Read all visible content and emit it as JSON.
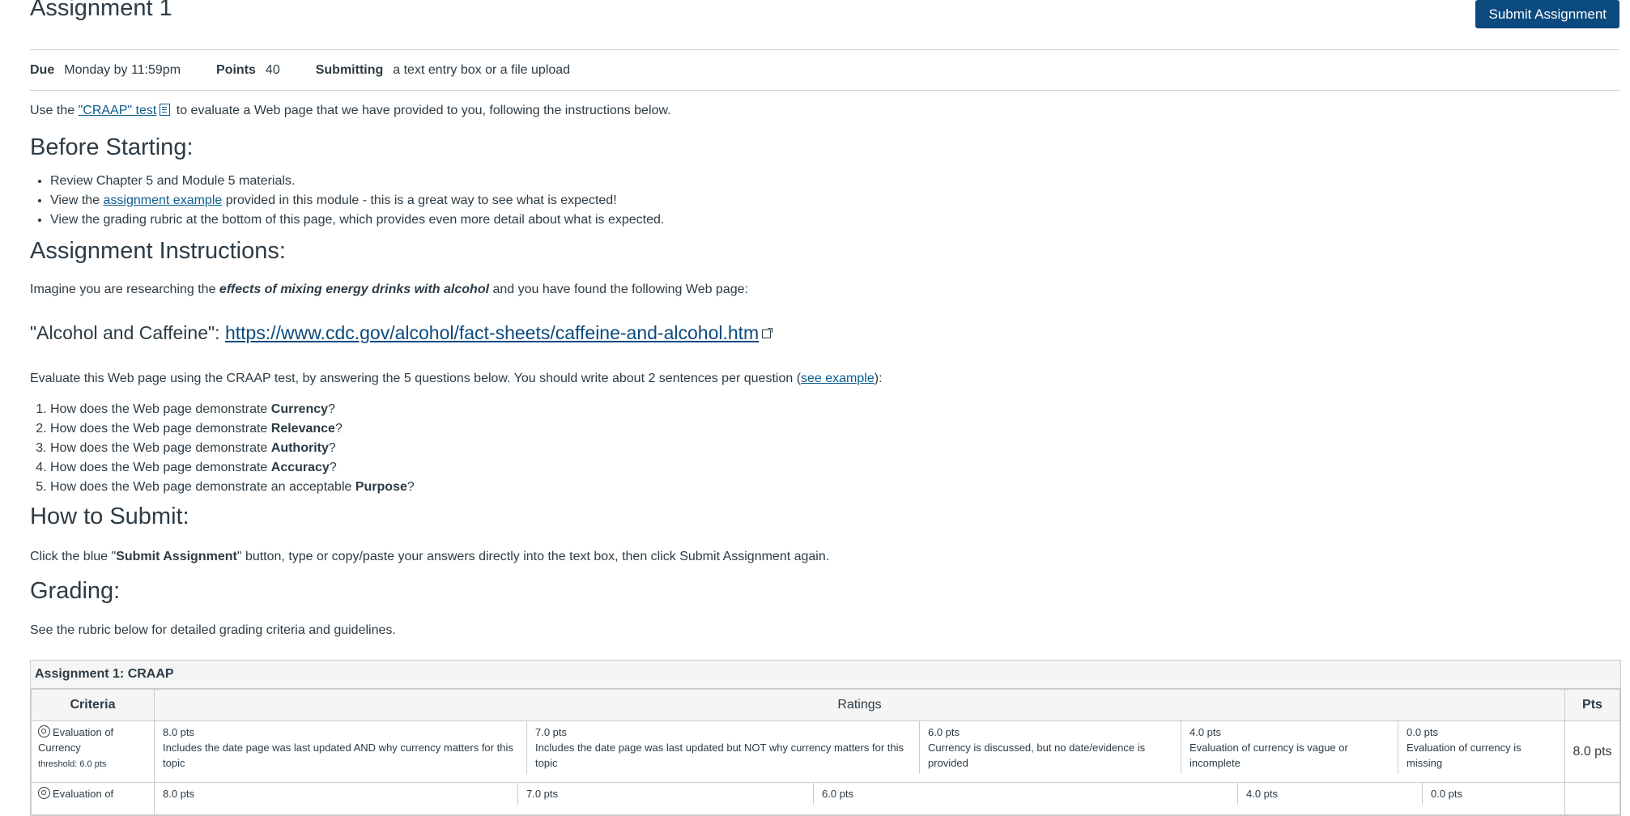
{
  "title": "Assignment 1",
  "submit_label": "Submit Assignment",
  "details": {
    "due_label": "Due",
    "due_value": "Monday by 11:59pm",
    "points_label": "Points",
    "points_value": "40",
    "submitting_label": "Submitting",
    "submitting_value": "a text entry box or a file upload"
  },
  "intro": {
    "pre": "Use the ",
    "link": "\"CRAAP\" test",
    "post": " to evaluate a Web page that we have provided to you, following the instructions below."
  },
  "before": {
    "heading": "Before Starting:",
    "item1": "Review Chapter 5 and Module 5 materials.",
    "item2_pre": "View the ",
    "item2_link": "assignment example",
    "item2_post": " provided in this module - this is a great way to see what is expected!",
    "item3": "View the grading rubric at the bottom of this page, which provides even more detail about what is expected."
  },
  "instructions": {
    "heading": "Assignment Instructions:",
    "imagine_pre": "Imagine you are researching the ",
    "imagine_em": "effects of mixing energy drinks with alcohol",
    "imagine_post": " and you have found the following Web page:",
    "cdc_label": "\"Alcohol and Caffeine\": ",
    "cdc_link": "https://www.cdc.gov/alcohol/fact-sheets/caffeine-and-alcohol.htm",
    "eval_pre": "Evaluate this Web page using the CRAAP test, by answering the 5 questions below. You should write about 2 sentences per question (",
    "eval_link": "see example",
    "eval_post": "):",
    "q_prefix": "How does the Web page demonstrate ",
    "q_prefix5": "How does the Web page demonstrate an acceptable ",
    "q1": "Currency",
    "q2": "Relevance",
    "q3": "Authority",
    "q4": "Accuracy",
    "q5": "Purpose"
  },
  "submit_section": {
    "heading": "How to Submit:",
    "pre": "Click the blue \"",
    "bold": "Submit Assignment",
    "post": "\" button, type or copy/paste your answers directly into the text box, then click Submit Assignment again."
  },
  "grading": {
    "heading": "Grading:",
    "text": "See the rubric below for detailed grading criteria and guidelines."
  },
  "rubric": {
    "title": "Assignment 1: CRAAP",
    "col_criteria": "Criteria",
    "col_ratings": "Ratings",
    "col_pts": "Pts",
    "row1": {
      "criterion_a": "Evaluation of",
      "criterion_b": "Currency",
      "threshold": "threshold: 6.0 pts",
      "r1_pts": "8.0 pts",
      "r1_desc": "Includes the date page was last updated AND why currency matters for this topic",
      "r2_pts": "7.0 pts",
      "r2_desc": "Includes the date page was last updated but NOT why currency matters for this topic",
      "r3_pts": "6.0 pts",
      "r3_desc": "Currency is discussed, but no date/evidence is provided",
      "r4_pts": "4.0 pts",
      "r4_desc": "Evaluation of currency is vague or incomplete",
      "r5_pts": "0.0 pts",
      "r5_desc": "Evaluation of currency is missing",
      "total": "8.0 pts"
    },
    "row2": {
      "criterion_a": "Evaluation of",
      "r1_pts": "8.0 pts",
      "r2_pts": "7.0 pts",
      "r3_pts": "6.0 pts",
      "r4_pts": "4.0 pts",
      "r5_pts": "0.0 pts"
    }
  }
}
